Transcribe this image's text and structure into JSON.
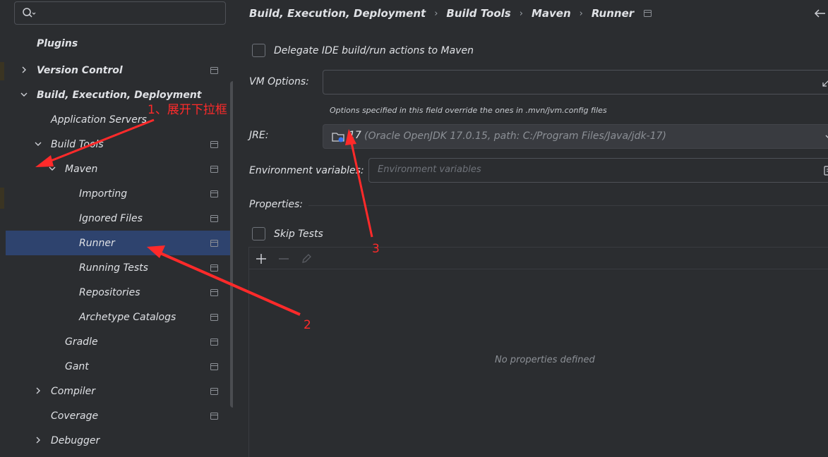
{
  "search": {
    "value": "",
    "placeholder": ""
  },
  "tree": {
    "items": [
      {
        "label": "Plugins",
        "bold": true,
        "expandable": false,
        "pg": false
      },
      {
        "label": "Version Control",
        "bold": true,
        "expandable": true,
        "expanded": false,
        "pg": true
      },
      {
        "label": "Build, Execution, Deployment",
        "bold": true,
        "expandable": true,
        "expanded": true,
        "pg": false
      },
      {
        "label": "Application Servers",
        "bold": false,
        "expandable": false,
        "pg": false
      },
      {
        "label": "Build Tools",
        "bold": false,
        "expandable": true,
        "expanded": true,
        "pg": true
      },
      {
        "label": "Maven",
        "bold": false,
        "expandable": true,
        "expanded": true,
        "pg": true
      },
      {
        "label": "Importing",
        "bold": false,
        "expandable": false,
        "pg": true
      },
      {
        "label": "Ignored Files",
        "bold": false,
        "expandable": false,
        "pg": true
      },
      {
        "label": "Runner",
        "bold": false,
        "expandable": false,
        "pg": true,
        "selected": true
      },
      {
        "label": "Running Tests",
        "bold": false,
        "expandable": false,
        "pg": true
      },
      {
        "label": "Repositories",
        "bold": false,
        "expandable": false,
        "pg": true
      },
      {
        "label": "Archetype Catalogs",
        "bold": false,
        "expandable": false,
        "pg": true
      },
      {
        "label": "Gradle",
        "bold": false,
        "expandable": false,
        "pg": true
      },
      {
        "label": "Gant",
        "bold": false,
        "expandable": false,
        "pg": true
      },
      {
        "label": "Compiler",
        "bold": false,
        "expandable": true,
        "expanded": false,
        "pg": true
      },
      {
        "label": "Coverage",
        "bold": false,
        "expandable": false,
        "pg": true
      },
      {
        "label": "Debugger",
        "bold": false,
        "expandable": true,
        "expanded": false,
        "pg": false
      }
    ]
  },
  "breadcrumb": {
    "items": [
      "Build, Execution, Deployment",
      "Build Tools",
      "Maven",
      "Runner"
    ],
    "separator": "›"
  },
  "form": {
    "delegate_label": "Delegate IDE build/run actions to Maven",
    "vm_options_label": "VM Options:",
    "vm_options_value": "",
    "vm_options_hint": "Options specified in this field override the ones in .mvn/jvm.config files",
    "jre_label": "JRE:",
    "jre_version": "17",
    "jre_detail": "(Oracle OpenJDK 17.0.15, path: C:/Program Files/Java/jdk-17)",
    "env_label": "Environment variables:",
    "env_placeholder": "Environment variables",
    "properties_title": "Properties:",
    "skip_tests_label": "Skip Tests",
    "empty_properties": "No properties defined"
  },
  "annotations": {
    "a1": "1、展开下拉框",
    "a2": "2",
    "a3": "3",
    "color": "#ff2a2a"
  },
  "colors": {
    "background": "#2b2d30",
    "selection": "#2e436e",
    "text": "#dfe1e5",
    "muted": "#8c9096"
  }
}
